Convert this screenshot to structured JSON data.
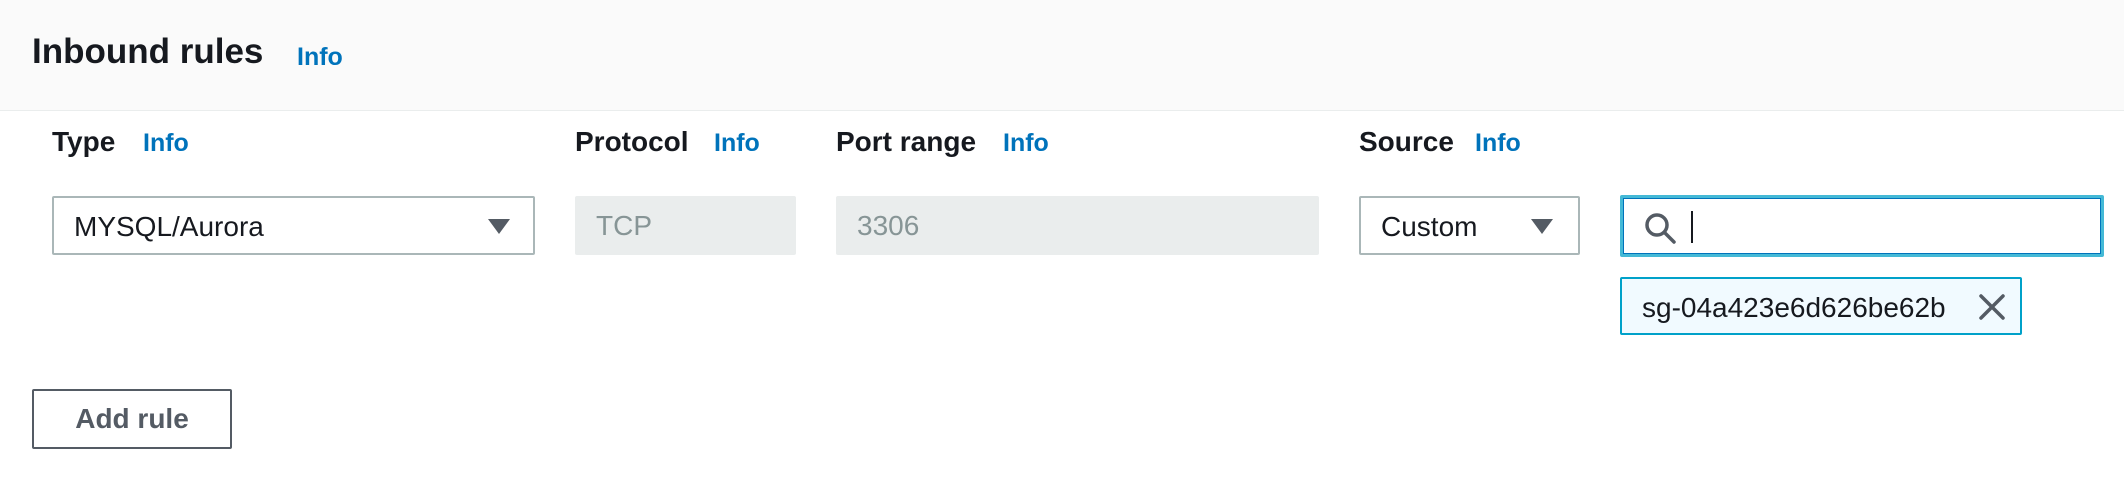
{
  "header": {
    "title": "Inbound rules",
    "info": "Info"
  },
  "columns": {
    "type": {
      "label": "Type",
      "info": "Info"
    },
    "protocol": {
      "label": "Protocol",
      "info": "Info"
    },
    "port_range": {
      "label": "Port range",
      "info": "Info"
    },
    "source": {
      "label": "Source",
      "info": "Info"
    }
  },
  "rule": {
    "type_value": "MYSQL/Aurora",
    "protocol_value": "TCP",
    "port_range_value": "3306",
    "source_value": "Custom",
    "search_value": "",
    "selected_token": "sg-04a423e6d626be62b"
  },
  "actions": {
    "add_rule": "Add rule"
  },
  "icons": {
    "search": "search-icon",
    "caret": "caret-down-icon",
    "close": "close-icon"
  },
  "colors": {
    "link": "#0073bb",
    "focus": "#44b9d6",
    "token_border": "#00a1c9",
    "token_bg": "#f1faff"
  }
}
